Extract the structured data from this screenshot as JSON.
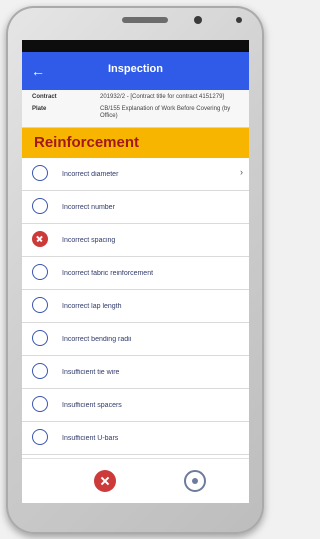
{
  "app": {
    "title": "Inspection"
  },
  "details": {
    "rows": [
      {
        "label": "Contract",
        "value": "201932/2 - [Contract title for contract 4151279]"
      },
      {
        "label": "Plate",
        "value": "CB/155 Explanation of Work Before Covering (by Office)"
      }
    ]
  },
  "section": {
    "title": "Reinforcement"
  },
  "list": {
    "items": [
      {
        "label": "Incorrect diameter",
        "selected": false
      },
      {
        "label": "Incorrect number",
        "selected": false
      },
      {
        "label": "Incorrect spacing",
        "selected": true
      },
      {
        "label": "Incorrect fabric reinforcement",
        "selected": false
      },
      {
        "label": "Incorrect lap length",
        "selected": false
      },
      {
        "label": "Incorrect bending radii",
        "selected": false
      },
      {
        "label": "Insufficient tie wire",
        "selected": false
      },
      {
        "label": "Insufficient spacers",
        "selected": false
      },
      {
        "label": "Insufficient U-bars",
        "selected": false
      }
    ]
  },
  "icons": {
    "back": "arrow-left-icon",
    "chevron": "chevron-right-icon",
    "cancel": "cancel-circle-icon",
    "info": "info-circle-icon"
  },
  "colors": {
    "appbar": "#2f5be8",
    "section_header_bg": "#f7b500",
    "section_header_text": "#a31818",
    "selected": "#cc3a3a"
  }
}
